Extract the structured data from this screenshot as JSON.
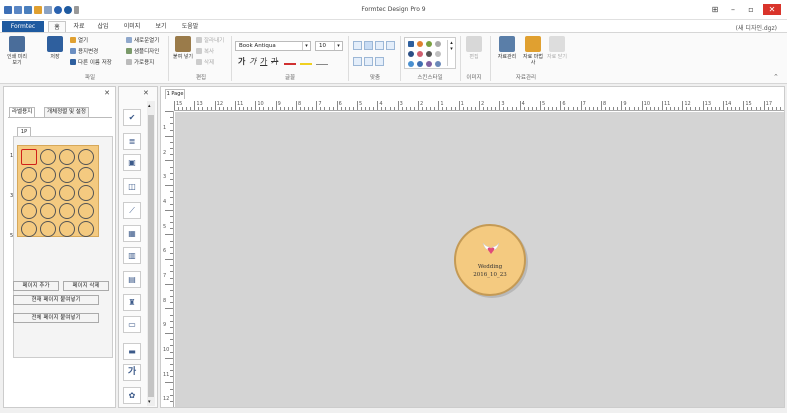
{
  "window": {
    "title": "Formtec Design Pro 9",
    "doc_name": "(새 디자인.dgz)",
    "controls": [
      "⊞",
      "–",
      "▫",
      "✕"
    ]
  },
  "menu": {
    "brand": "Formtec",
    "tabs": [
      "홈",
      "자료",
      "삽입",
      "이미지",
      "보기",
      "도움말"
    ]
  },
  "ribbon": {
    "file": {
      "label": "파일",
      "print_preview": "인쇄 미리보기",
      "save": "저장",
      "open": "열기",
      "change_paper": "용지변경",
      "save_as": "다른 이름 저장",
      "new_open": "새로운열기",
      "create_template": "샘플디자인",
      "horizontal_paper": "가로용지"
    },
    "edit": {
      "label": "편집",
      "paste": "붙여 넣기",
      "cut": "잘라내기",
      "copy": "복사",
      "delete": "삭제"
    },
    "font": {
      "label": "글꼴",
      "family": "Book Antiqua",
      "size": "10",
      "bold": "가",
      "italic": "가",
      "underline": "가",
      "strike": "가"
    },
    "align": {
      "label": "맞춤"
    },
    "quick_style": {
      "label": "스킨스타일"
    },
    "image": {
      "label": "이미지",
      "edit": "편집"
    },
    "data": {
      "label": "자료관리",
      "manage": "자료관리",
      "wizard": "자료 마법사",
      "close": "자료 닫기"
    }
  },
  "left_panel": {
    "tabs": [
      "라벨용지",
      "개체정렬 및 설정"
    ],
    "sheet_tab": "1P",
    "row_numbers": [
      "1",
      "3",
      "5"
    ],
    "buttons": {
      "add_page": "페이지 추가",
      "delete_page": "페이지 삭제",
      "paste_current": "현재 페이지 붙여넣기",
      "paste_all": "전체 페이지 붙여넣기"
    }
  },
  "toolbox": {
    "tools": [
      "select-tool",
      "text-tool",
      "image-tool",
      "shape-tool",
      "line-tool",
      "table-tool",
      "barcode-tool",
      "qrcode-tool",
      "stamp-tool",
      "frame-tool",
      "memo-tool",
      "hangul-tool",
      "clipart-tool"
    ],
    "hangul_glyph": "가"
  },
  "document": {
    "page_tab": "1 Page",
    "ruler_h": [
      "15",
      "13",
      "12",
      "11",
      "10",
      "9",
      "8",
      "7",
      "6",
      "5",
      "4",
      "3",
      "2",
      "1",
      "1",
      "2",
      "3",
      "4",
      "5",
      "6",
      "7",
      "8",
      "9",
      "10",
      "11",
      "12",
      "13",
      "14",
      "15",
      "17"
    ],
    "ruler_v": [
      "1",
      "2",
      "3",
      "4",
      "5",
      "6",
      "7",
      "8",
      "9",
      "10",
      "11",
      "12"
    ],
    "label": {
      "title": "Wedding",
      "date": "2016_10_23"
    }
  },
  "colors": {
    "brand": "#1e5aa0",
    "label_fill": "#f4ca80",
    "canvas": "#d4d4d4",
    "close": "#d9342b",
    "selection": "#d0201a"
  }
}
